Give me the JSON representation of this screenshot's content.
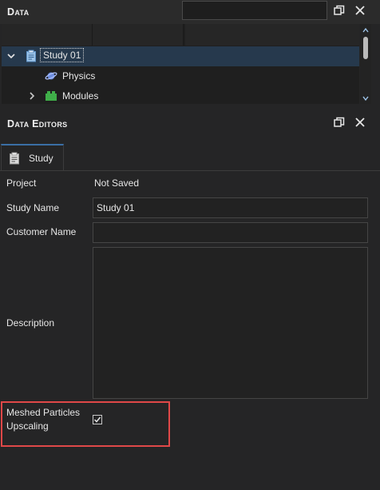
{
  "data_panel": {
    "title": "Data",
    "search_value": "",
    "tree": [
      {
        "label": "Study 01",
        "expanded": true,
        "icon": "study-clipboard-icon"
      },
      {
        "label": "Physics",
        "icon": "physics-planet-icon"
      },
      {
        "label": "Modules",
        "expanded": false,
        "icon": "modules-blocks-icon"
      }
    ]
  },
  "editors_panel": {
    "title": "Data Editors",
    "tab_label": "Study",
    "fields": {
      "project_label": "Project",
      "project_value": "Not Saved",
      "study_name_label": "Study Name",
      "study_name_value": "Study 01",
      "customer_name_label": "Customer Name",
      "customer_name_value": "",
      "description_label": "Description",
      "description_value": "",
      "upscaling_label_line1": "Meshed Particles",
      "upscaling_label_line2": "Upscaling",
      "upscaling_checked": true
    }
  },
  "colors": {
    "background": "#252526",
    "selection": "#26394d",
    "highlight": "#e04848",
    "tab_accent": "#3a6ea5"
  }
}
